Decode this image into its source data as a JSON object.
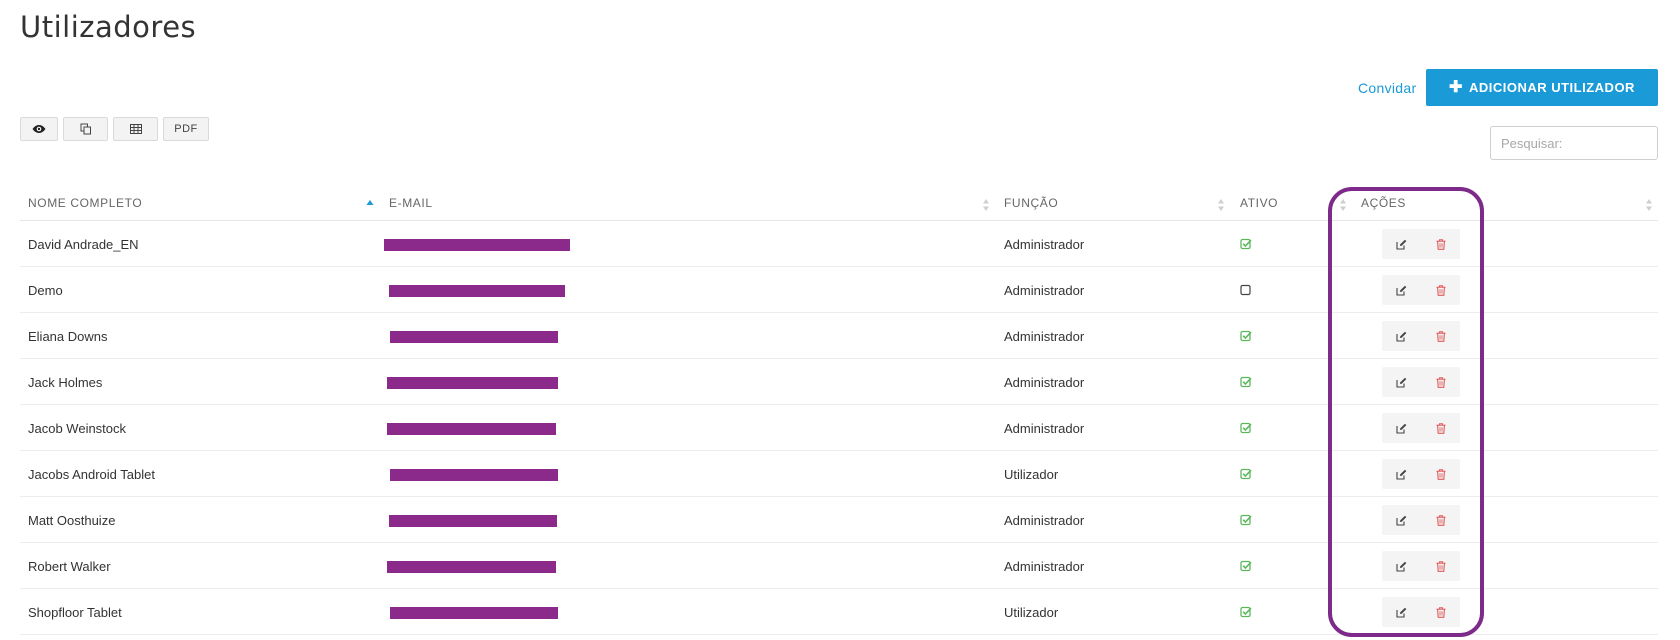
{
  "page": {
    "title": "Utilizadores"
  },
  "header": {
    "invite_label": "Convidar",
    "add_user_label": "ADICIONAR UTILIZADOR"
  },
  "export_buttons": [
    {
      "icon": "eye-icon"
    },
    {
      "icon": "copy-icon"
    },
    {
      "icon": "table-icon"
    },
    {
      "label": "PDF"
    }
  ],
  "search": {
    "placeholder": "Pesquisar:"
  },
  "table": {
    "columns": [
      "NOME COMPLETO",
      "E-MAIL",
      "FUNÇÃO",
      "ATIVO",
      "AÇÕES"
    ],
    "rows": [
      {
        "name": "David Andrade_EN",
        "role": "Administrador",
        "active": true
      },
      {
        "name": "Demo",
        "role": "Administrador",
        "active": false
      },
      {
        "name": "Eliana Downs",
        "role": "Administrador",
        "active": true
      },
      {
        "name": "Jack Holmes",
        "role": "Administrador",
        "active": true
      },
      {
        "name": "Jacob Weinstock",
        "role": "Administrador",
        "active": true
      },
      {
        "name": "Jacobs Android Tablet",
        "role": "Utilizador",
        "active": true
      },
      {
        "name": "Matt Oosthuize",
        "role": "Administrador",
        "active": true
      },
      {
        "name": "Robert Walker",
        "role": "Administrador",
        "active": true
      },
      {
        "name": "Shopfloor Tablet",
        "role": "Utilizador",
        "active": true
      }
    ]
  },
  "colors": {
    "accent": "#1a9ad6",
    "active_check": "#5cb85c",
    "delete": "#e05c5c",
    "redaction": "#8b2a8b",
    "highlight": "#7d2a8a"
  }
}
